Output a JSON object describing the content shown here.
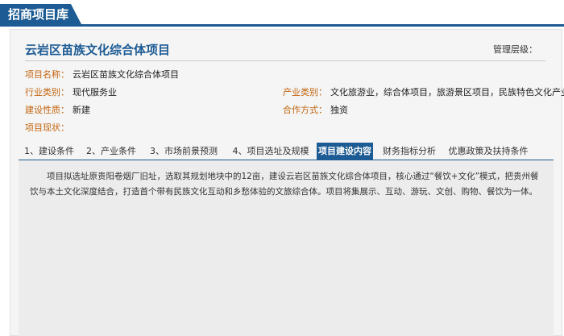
{
  "header": {
    "title": "招商项目库"
  },
  "project": {
    "title": "云岩区苗族文化综合体项目",
    "level_label": "管理层级："
  },
  "fields": {
    "name": {
      "label": "项目名称：",
      "value": "云岩区苗族文化综合体项目"
    },
    "industry": {
      "label": "行业类别：",
      "value": "现代服务业"
    },
    "sector": {
      "label": "产业类别：",
      "value": "文化旅游业，综合体项目，旅游景区项目，民族特色文化产业"
    },
    "nature": {
      "label": "建设性质：",
      "value": "新建"
    },
    "cooperation": {
      "label": "合作方式：",
      "value": "独资"
    },
    "status": {
      "label": "项目现状：",
      "value": ""
    }
  },
  "tabs": [
    {
      "label": "1、建设条件"
    },
    {
      "label": "2、产业条件"
    },
    {
      "label": "3、市场前景预测"
    },
    {
      "label": "4、项目选址及规模"
    },
    {
      "label": "项目建设内容"
    },
    {
      "label": "财务指标分析"
    },
    {
      "label": "优惠政策及扶持条件"
    }
  ],
  "active_tab": "项目建设内容",
  "content": {
    "text": "项目拟选址原贵阳卷烟厂旧址，选取其规划地块中的12亩，建设云岩区苗族文化综合体项目，核心通过“餐饮+文化”模式，把贵州餐饮与本土文化深度结合，打造首个带有民族文化互动和乡愁体验的文旅综合体。项目将集展示、互动、游玩、文创、购物、餐饮为一体。"
  },
  "colors": {
    "brand": "#1d5b94",
    "label": "#c3640e",
    "content_bg": "#ececec"
  }
}
